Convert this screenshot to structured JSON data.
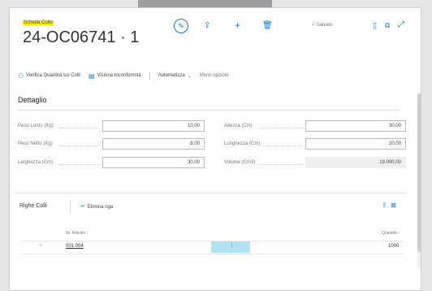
{
  "header": {
    "caption": "Scheda Collo",
    "title": "24-OC06741 · 1",
    "saved_label": "✓ Salvato",
    "icons": [
      "pencil-icon",
      "share-icon",
      "plus-icon",
      "trash-icon",
      "bookmark-icon",
      "open-new-icon",
      "expand-icon"
    ]
  },
  "actions": [
    {
      "label": "Verifica Quantità sui Colli",
      "icon": "user-check-icon"
    },
    {
      "label": "Visiona Inconformità",
      "icon": "document-icon"
    },
    {
      "label": "Automatizza",
      "icon": "chevron-down-icon"
    },
    {
      "label": "Meno opzioni",
      "icon": ""
    }
  ],
  "dettaglio": {
    "title": "Dettaglio",
    "left_fields": [
      {
        "label": "Peso Lordo (Kg)",
        "value": "10,00"
      },
      {
        "label": "Peso Netto (Kg)",
        "value": "8,00"
      },
      {
        "label": "Larghezza (Cm)",
        "value": "30,00"
      }
    ],
    "right_fields": [
      {
        "label": "Altezza (Cm)",
        "value": "30,00"
      },
      {
        "label": "Lunghezza (Cm)",
        "value": "20,00"
      },
      {
        "label": "Volume (Cm3)",
        "value": "18.000,00"
      }
    ]
  },
  "righe": {
    "title": "Righe Colli",
    "delete_label": "Elimina riga",
    "columns": {
      "article": "Nr. Articolo ↑",
      "qty": "Quantità ↑"
    },
    "rows": [
      {
        "article": "001.004",
        "qty": "1000"
      }
    ]
  }
}
